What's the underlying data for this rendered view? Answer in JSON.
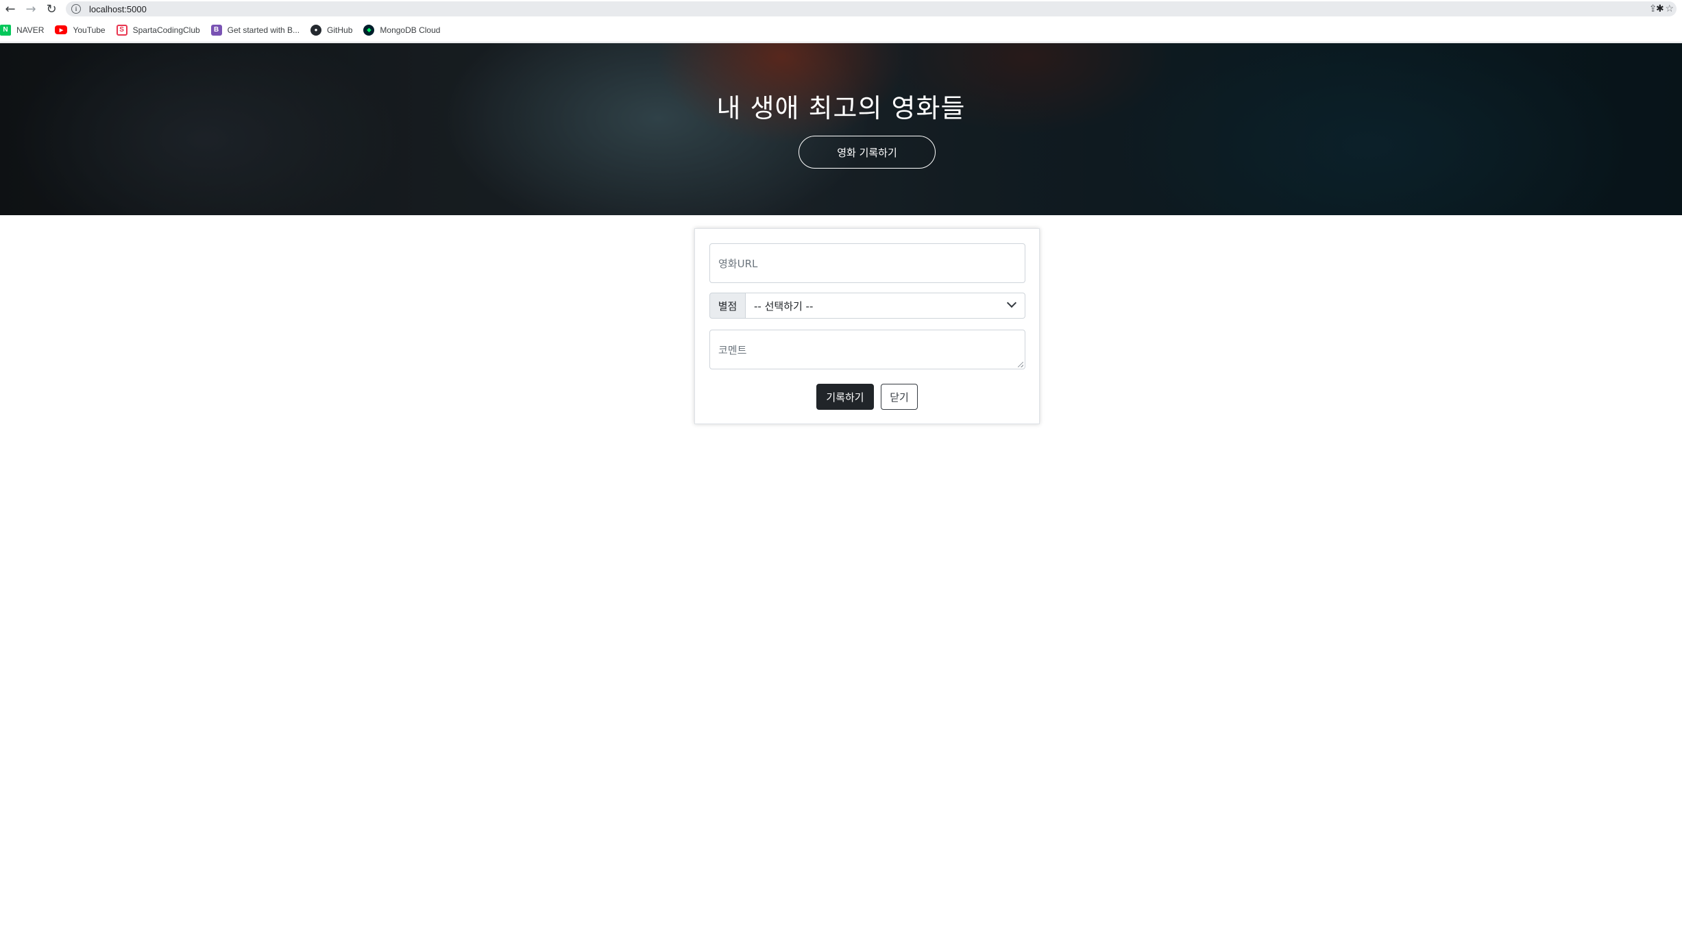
{
  "browser": {
    "url": "localhost:5000",
    "bookmarks": [
      {
        "label": "NAVER",
        "icon": "naver-icon",
        "glyph": "N"
      },
      {
        "label": "YouTube",
        "icon": "youtube-icon",
        "glyph": "▶"
      },
      {
        "label": "SpartaCodingClub",
        "icon": "sparta-icon",
        "glyph": "S"
      },
      {
        "label": "Get started with B...",
        "icon": "bootstrap-icon",
        "glyph": "B"
      },
      {
        "label": "GitHub",
        "icon": "github-icon",
        "glyph": "●"
      },
      {
        "label": "MongoDB Cloud",
        "icon": "mongodb-icon",
        "glyph": "◆"
      }
    ]
  },
  "hero": {
    "title": "내 생애 최고의 영화들",
    "button_label": "영화 기록하기"
  },
  "form": {
    "url_placeholder": "영화URL",
    "rating_label": "별점",
    "rating_selected": "-- 선택하기 --",
    "comment_placeholder": "코멘트",
    "submit_label": "기록하기",
    "close_label": "닫기"
  },
  "colors": {
    "button_dark": "#212529",
    "input_border": "#ced4da"
  }
}
